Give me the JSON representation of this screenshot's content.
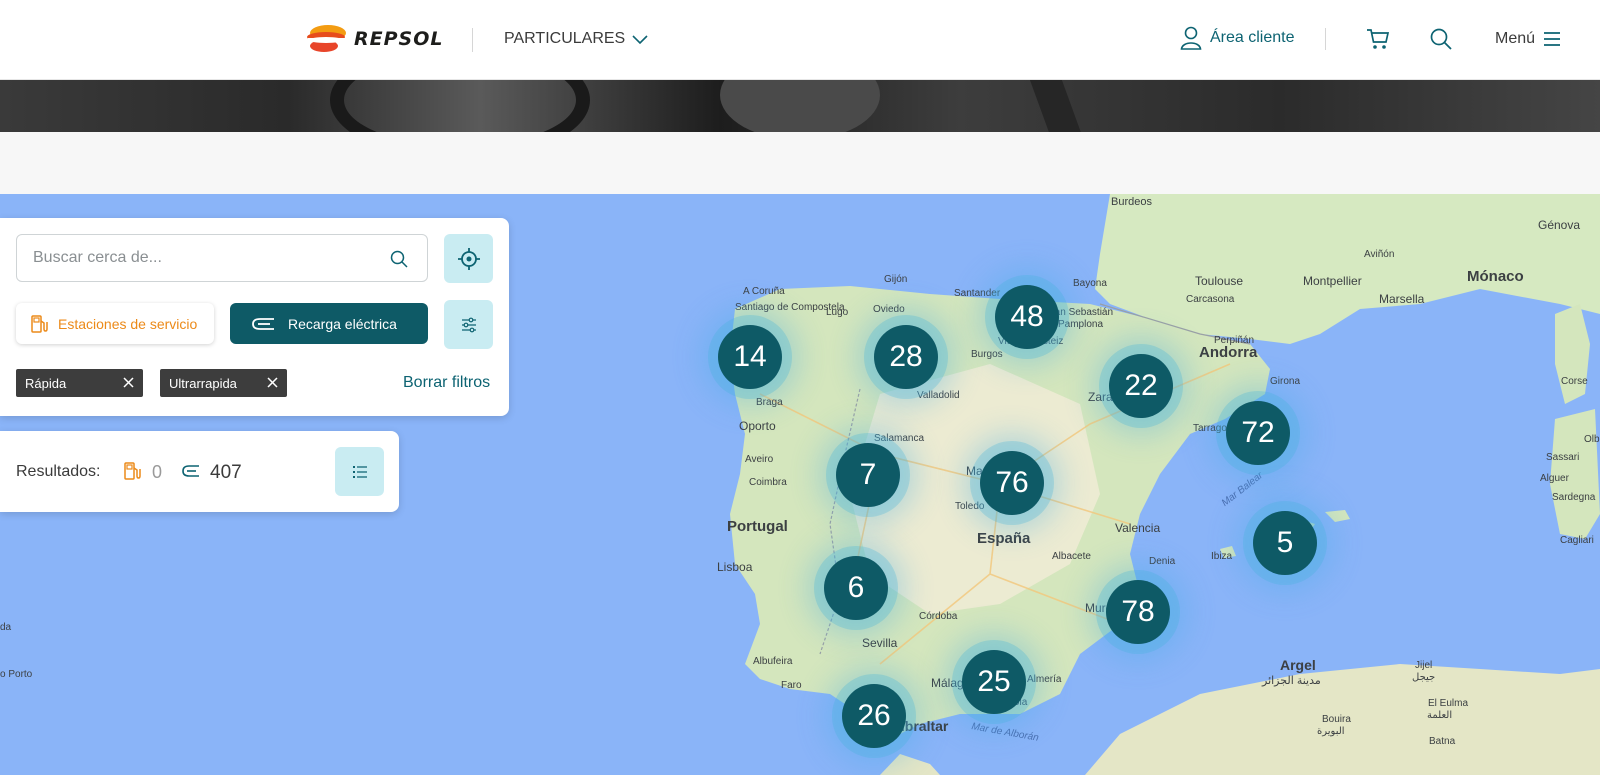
{
  "header": {
    "brand": "REPSOL",
    "nav_particulares": "PARTICULARES",
    "area_cliente": "Área cliente",
    "menu": "Menú"
  },
  "search": {
    "placeholder": "Buscar cerca de..."
  },
  "filters": {
    "estaciones_label": "Estaciones de servicio",
    "recarga_label": "Recarga eléctrica",
    "chips": [
      "Rápida",
      "Ultrarrapida"
    ],
    "clear_label": "Borrar filtros"
  },
  "results": {
    "label": "Resultados:",
    "fuel_count": "0",
    "ev_count": "407"
  },
  "map": {
    "clusters": [
      "14",
      "28",
      "48",
      "22",
      "72",
      "7",
      "76",
      "5",
      "6",
      "78",
      "25",
      "26"
    ],
    "labels": {
      "portugal": "Portugal",
      "espana": "España",
      "andorra": "Andorra",
      "monaco": "Mónaco",
      "argel": "Argel",
      "argel_ar": "مدينة الجزائر",
      "burdeos": "Burdeos",
      "toulouse": "Toulouse",
      "montpellier": "Montpellier",
      "marsella": "Marsella",
      "carcasona": "Carcasona",
      "perpinan": "Perpiñán",
      "genova": "Génova",
      "avinon": "Aviñón",
      "bayona": "Bayona",
      "coruna": "A Coruña",
      "santiago": "Santiago de Compostela",
      "lugo": "Lugo",
      "gijon": "Gijón",
      "oviedo": "Oviedo",
      "santander": "Santander",
      "sebastian": "San Sebastián",
      "pamplona": "Pamplona",
      "vitoria": "Vitoria-Gasteiz",
      "burgos": "Burgos",
      "valladolid": "Valladolid",
      "braga": "Braga",
      "oporto": "Oporto",
      "aveiro": "Aveiro",
      "coimbra": "Coimbra",
      "salamanca": "Salamanca",
      "madrid": "Madrid",
      "toledo": "Toledo",
      "zaragoza": "Zaragoza",
      "tarragona": "Tarragona",
      "girona": "Girona",
      "valencia": "Valencia",
      "albacete": "Albacete",
      "denia": "Denia",
      "ibiza": "Ibiza",
      "murcia": "Murcia",
      "lisboa": "Lisboa",
      "sevilla": "Sevilla",
      "cordoba": "Córdoba",
      "albufeira": "Albufeira",
      "faro": "Faro",
      "malaga": "Málaga",
      "marbella": "Marbella",
      "fuengirola": "Fuengirola",
      "almeria": "Almería",
      "gibraltar": "Gibraltar",
      "mar_balear": "Mar Balear",
      "mar_alboran": "Mar de Alborán",
      "corse": "Corse",
      "sassari": "Sassari",
      "alguer": "Alguer",
      "sardegna": "Sardegna",
      "cagliari": "Cagliari",
      "olbia": "Olbi",
      "jijel": "Jijel",
      "jijel_ar": "جيجل",
      "bouira": "Bouira",
      "bouira_ar": "البويرة",
      "el_eulma": "El Eulma",
      "el_eulma_ar": "العلمة",
      "batna": "Batna",
      "porto_partial": "o Porto",
      "da_partial": "da"
    }
  },
  "colors": {
    "primary": "#0e5a66",
    "accent_light": "#c9ecf2",
    "fuel_orange": "#ec8a19",
    "link": "#0d6372",
    "water": "#8ab4f8",
    "land": "#cfe6b8"
  }
}
